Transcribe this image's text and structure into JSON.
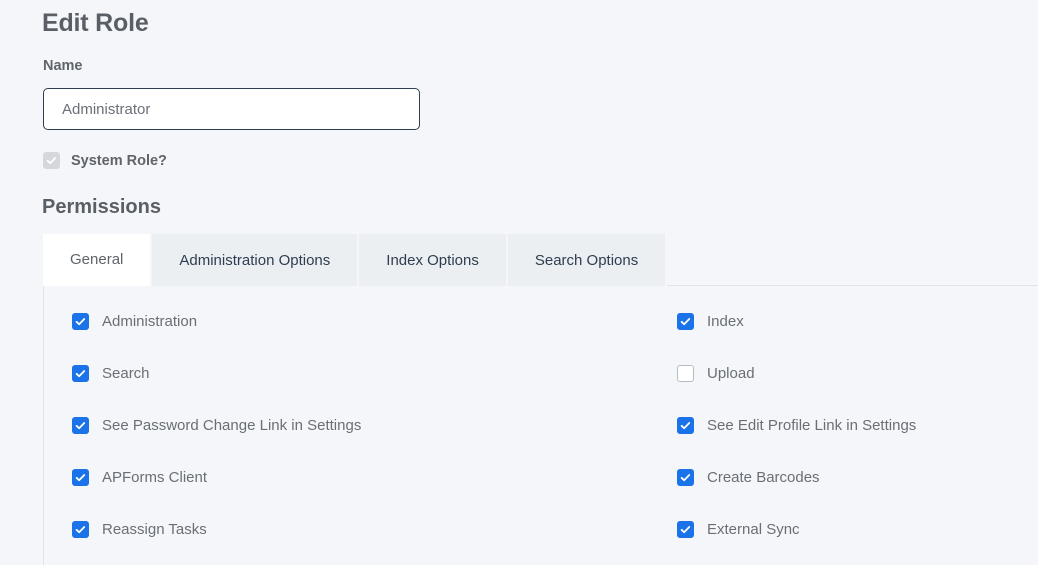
{
  "header": {
    "title": "Edit Role"
  },
  "name_field": {
    "label": "Name",
    "value": "Administrator",
    "placeholder": "Administrator"
  },
  "system_role": {
    "label": "System Role?",
    "checked": true,
    "disabled": true
  },
  "permissions_section": {
    "title": "Permissions"
  },
  "tabs": [
    {
      "label": "General",
      "active": true
    },
    {
      "label": "Administration Options",
      "active": false
    },
    {
      "label": "Index Options",
      "active": false
    },
    {
      "label": "Search Options",
      "active": false
    }
  ],
  "permissions": {
    "left_column": [
      {
        "label": "Administration",
        "checked": true
      },
      {
        "label": "Search",
        "checked": true
      },
      {
        "label": "See Password Change Link in Settings",
        "checked": true
      },
      {
        "label": "APForms Client",
        "checked": true
      },
      {
        "label": "Reassign Tasks",
        "checked": true
      }
    ],
    "right_column": [
      {
        "label": "Index",
        "checked": true
      },
      {
        "label": "Upload",
        "checked": false
      },
      {
        "label": "See Edit Profile Link in Settings",
        "checked": true
      },
      {
        "label": "Create Barcodes",
        "checked": true
      },
      {
        "label": "External Sync",
        "checked": true
      }
    ]
  },
  "colors": {
    "page_background": "#f4f6fa",
    "checkbox_checked": "#1a73e8",
    "checkbox_disabled": "#d4d8dd",
    "input_border": "#2d3e50",
    "tab_inactive_background": "#eceff1",
    "tab_active_background": "#ffffff",
    "heading_text": "#5a5f66",
    "label_text": "#6a6f76"
  }
}
